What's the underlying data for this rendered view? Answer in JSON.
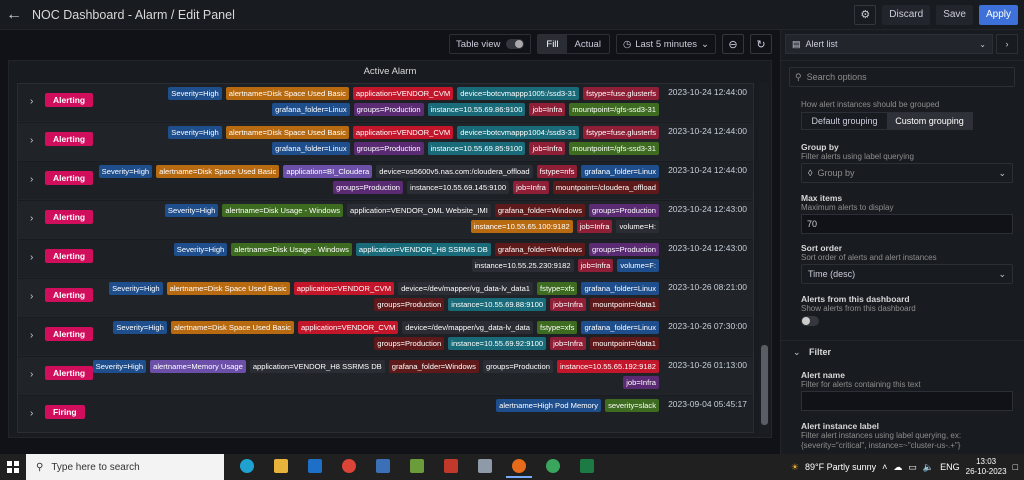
{
  "header": {
    "title": "NOC Dashboard - Alarm / Edit Panel",
    "discard_label": "Discard",
    "save_label": "Save",
    "apply_label": "Apply"
  },
  "panel_toolbar": {
    "table_view_label": "Table view",
    "fill_label": "Fill",
    "actual_label": "Actual",
    "time_range": "Last 5 minutes"
  },
  "panel": {
    "title": "Active Alarm"
  },
  "alerts": [
    {
      "state": "Alerting",
      "time": "2023-10-24 12:44:00",
      "labels": [
        {
          "text": "Severity=High",
          "color": "#1f4e8c"
        },
        {
          "text": "alertname=Disk Space Used Basic",
          "color": "#b86a10"
        },
        {
          "text": "application=VENDOR_CVM",
          "color": "#c4162a"
        },
        {
          "text": "device=botcvmappp1005:/ssd3-31",
          "color": "#1a6b7a"
        },
        {
          "text": "fstype=fuse.glusterfs",
          "color": "#8f1f36"
        },
        {
          "text": "grafana_folder=Linux",
          "color": "#1f4e8c"
        },
        {
          "text": "groups=Production",
          "color": "#5a2b73"
        },
        {
          "text": "instance=10.55.69.86:9100",
          "color": "#1a6b7a"
        },
        {
          "text": "job=Infra",
          "color": "#8f1f36"
        },
        {
          "text": "mountpoint=/gfs-ssd3-31",
          "color": "#3d6b1f"
        }
      ]
    },
    {
      "state": "Alerting",
      "time": "2023-10-24 12:44:00",
      "labels": [
        {
          "text": "Severity=High",
          "color": "#1f4e8c"
        },
        {
          "text": "alertname=Disk Space Used Basic",
          "color": "#b86a10"
        },
        {
          "text": "application=VENDOR_CVM",
          "color": "#c4162a"
        },
        {
          "text": "device=botcvmappp1004:/ssd3-31",
          "color": "#1a6b7a"
        },
        {
          "text": "fstype=fuse.glusterfs",
          "color": "#8f1f36"
        },
        {
          "text": "grafana_folder=Linux",
          "color": "#1f4e8c"
        },
        {
          "text": "groups=Production",
          "color": "#5a2b73"
        },
        {
          "text": "instance=10.55.69.85:9100",
          "color": "#1a6b7a"
        },
        {
          "text": "job=Infra",
          "color": "#8f1f36"
        },
        {
          "text": "mountpoint=/gfs-ssd3-31",
          "color": "#3d6b1f"
        }
      ]
    },
    {
      "state": "Alerting",
      "time": "2023-10-24 12:44:00",
      "labels": [
        {
          "text": "Severity=High",
          "color": "#1f4e8c"
        },
        {
          "text": "alertname=Disk Space Used Basic",
          "color": "#b86a10"
        },
        {
          "text": "application=BI_Cloudera",
          "color": "#6b4fa8"
        },
        {
          "text": "device=os5600v5.nas.com:/cloudera_offload",
          "color": "#2a2d33"
        },
        {
          "text": "fstype=nfs",
          "color": "#8f1f36"
        },
        {
          "text": "grafana_folder=Linux",
          "color": "#1f4e8c"
        },
        {
          "text": "groups=Production",
          "color": "#5a2b73"
        },
        {
          "text": "instance=10.55.69.145:9100",
          "color": "#2a2d33"
        },
        {
          "text": "job=Infra",
          "color": "#8f1f36"
        },
        {
          "text": "mountpoint=/cloudera_offload",
          "color": "#5e1a1a"
        }
      ]
    },
    {
      "state": "Alerting",
      "time": "2023-10-24 12:43:00",
      "labels": [
        {
          "text": "Severity=High",
          "color": "#1f4e8c"
        },
        {
          "text": "alertname=Disk Usage - Windows",
          "color": "#3d6b1f"
        },
        {
          "text": "application=VENDOR_OML Website_IMI",
          "color": "#2a2d33"
        },
        {
          "text": "grafana_folder=Windows",
          "color": "#5e1a1a"
        },
        {
          "text": "groups=Production",
          "color": "#5a2b73"
        },
        {
          "text": "instance=10.55.65.100:9182",
          "color": "#b86a10"
        },
        {
          "text": "job=Infra",
          "color": "#8f1f36"
        },
        {
          "text": "volume=H:",
          "color": "#2a2d33"
        }
      ]
    },
    {
      "state": "Alerting",
      "time": "2023-10-24 12:43:00",
      "labels": [
        {
          "text": "Severity=High",
          "color": "#1f4e8c"
        },
        {
          "text": "alertname=Disk Usage - Windows",
          "color": "#3d6b1f"
        },
        {
          "text": "application=VENDOR_H8 SSRMS DB",
          "color": "#1a6b7a"
        },
        {
          "text": "grafana_folder=Windows",
          "color": "#5e1a1a"
        },
        {
          "text": "groups=Production",
          "color": "#5a2b73"
        },
        {
          "text": "instance=10.55.25.230:9182",
          "color": "#2a2d33"
        },
        {
          "text": "job=Infra",
          "color": "#8f1f36"
        },
        {
          "text": "volume=F:",
          "color": "#1f4e8c"
        }
      ]
    },
    {
      "state": "Alerting",
      "time": "2023-10-26 08:21:00",
      "labels": [
        {
          "text": "Severity=High",
          "color": "#1f4e8c"
        },
        {
          "text": "alertname=Disk Space Used Basic",
          "color": "#b86a10"
        },
        {
          "text": "application=VENDOR_CVM",
          "color": "#c4162a"
        },
        {
          "text": "device=/dev/mapper/vg_data-lv_data1",
          "color": "#2a2d33"
        },
        {
          "text": "fstype=xfs",
          "color": "#3d6b1f"
        },
        {
          "text": "grafana_folder=Linux",
          "color": "#1f4e8c"
        },
        {
          "text": "groups=Production",
          "color": "#5e1a1a"
        },
        {
          "text": "instance=10.55.69.88:9100",
          "color": "#1a6b7a"
        },
        {
          "text": "job=Infra",
          "color": "#8f1f36"
        },
        {
          "text": "mountpoint=/data1",
          "color": "#5e1a1a"
        }
      ]
    },
    {
      "state": "Alerting",
      "time": "2023-10-26 07:30:00",
      "labels": [
        {
          "text": "Severity=High",
          "color": "#1f4e8c"
        },
        {
          "text": "alertname=Disk Space Used Basic",
          "color": "#b86a10"
        },
        {
          "text": "application=VENDOR_CVM",
          "color": "#c4162a"
        },
        {
          "text": "device=/dev/mapper/vg_data-lv_data",
          "color": "#2a2d33"
        },
        {
          "text": "fstype=xfs",
          "color": "#3d6b1f"
        },
        {
          "text": "grafana_folder=Linux",
          "color": "#1f4e8c"
        },
        {
          "text": "groups=Production",
          "color": "#5e1a1a"
        },
        {
          "text": "instance=10.55.69.92:9100",
          "color": "#1a6b7a"
        },
        {
          "text": "job=Infra",
          "color": "#8f1f36"
        },
        {
          "text": "mountpoint=/data1",
          "color": "#5e1a1a"
        }
      ]
    },
    {
      "state": "Alerting",
      "time": "2023-10-26 01:13:00",
      "labels": [
        {
          "text": "Severity=High",
          "color": "#1f4e8c"
        },
        {
          "text": "alertname=Memory Usage",
          "color": "#6b4fa8"
        },
        {
          "text": "application=VENDOR_H8 SSRMS DB",
          "color": "#2a2d33"
        },
        {
          "text": "grafana_folder=Windows",
          "color": "#5e1a1a"
        },
        {
          "text": "groups=Production",
          "color": "#2a2d33"
        },
        {
          "text": "instance=10.55.65.192:9182",
          "color": "#c4162a"
        },
        {
          "text": "job=Infra",
          "color": "#5a2b73"
        }
      ]
    },
    {
      "state": "Firing",
      "time": "2023-09-04 05:45:17",
      "labels": [
        {
          "text": "alertname=High Pod Memory",
          "color": "#1f4e8c"
        },
        {
          "text": "severity=slack",
          "color": "#3d6b1f"
        }
      ]
    }
  ],
  "options": {
    "visualization": "Alert list",
    "search_placeholder": "Search options",
    "grouping_desc": "How alert instances should be grouped",
    "default_grouping": "Default grouping",
    "custom_grouping": "Custom grouping",
    "group_by_title": "Group by",
    "group_by_desc": "Filter alerts using label querying",
    "group_by_placeholder": "Group by",
    "max_items_title": "Max items",
    "max_items_desc": "Maximum alerts to display",
    "max_items_value": "70",
    "sort_title": "Sort order",
    "sort_desc": "Sort order of alerts and alert instances",
    "sort_value": "Time (desc)",
    "dash_title": "Alerts from this dashboard",
    "dash_desc": "Show alerts from this dashboard",
    "filter_section": "Filter",
    "alert_name_title": "Alert name",
    "alert_name_desc": "Filter for alerts containing this text",
    "instance_label_title": "Alert instance label",
    "instance_label_desc": "Filter alert instances using label querying, ex: {severity=\"critical\", instance=~\"cluster-us-.+\"}"
  },
  "taskbar": {
    "search_placeholder": "Type here to search",
    "weather": "89°F  Partly sunny",
    "lang": "ENG",
    "time": "13:03",
    "date": "26-10-2023"
  }
}
